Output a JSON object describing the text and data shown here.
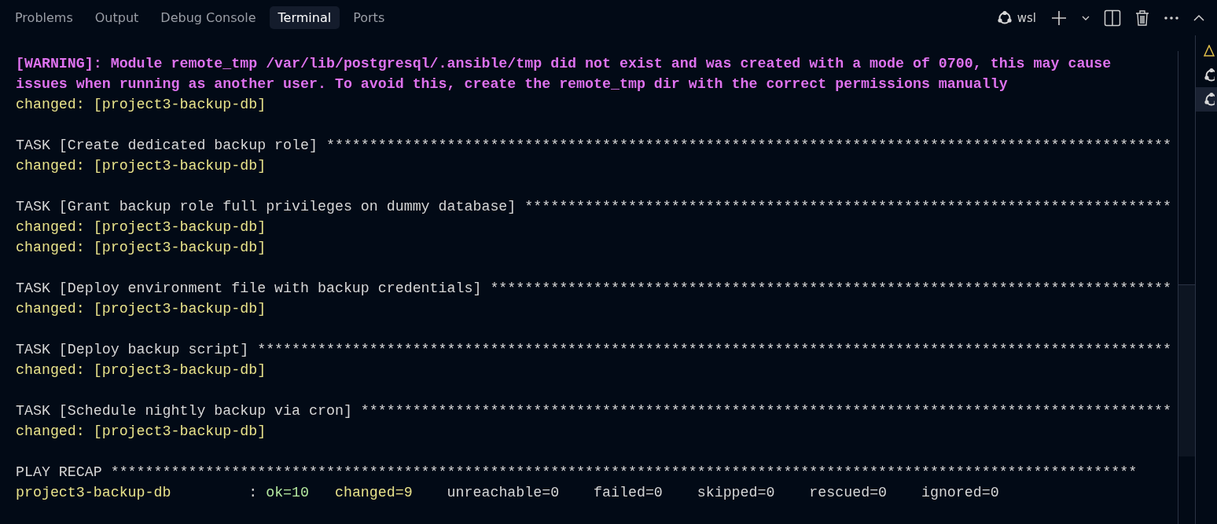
{
  "tabs": [
    {
      "label": "Problems",
      "selected": false
    },
    {
      "label": "Output",
      "selected": false
    },
    {
      "label": "Debug Console",
      "selected": false
    },
    {
      "label": "Terminal",
      "selected": true
    },
    {
      "label": "Ports",
      "selected": false
    }
  ],
  "toolbar": {
    "profile": "wsl"
  },
  "terminal": {
    "lines": [
      {
        "kind": "text",
        "segments": [
          {
            "text": "[WARNING]: Module remote_tmp /var/lib/postgresql/.ansible/tmp did not exist and was created with a mode of 0700, this may cause",
            "kind": "warning"
          }
        ]
      },
      {
        "kind": "text",
        "segments": [
          {
            "text": "issues when running as another user. To avoid this, create the remote_tmp dir with the correct permissions manually",
            "kind": "warning"
          }
        ]
      },
      {
        "kind": "text",
        "segments": [
          {
            "text": "changed: [project3-backup-db]",
            "kind": "changed"
          }
        ]
      },
      {
        "kind": "blank"
      },
      {
        "kind": "text",
        "segments": [
          {
            "text": "TASK [Create dedicated backup role] **************************************************************************************************",
            "kind": "plain"
          }
        ]
      },
      {
        "kind": "text",
        "segments": [
          {
            "text": "changed: [project3-backup-db]",
            "kind": "changed"
          }
        ]
      },
      {
        "kind": "blank"
      },
      {
        "kind": "text",
        "segments": [
          {
            "text": "TASK [Grant backup role full privileges on dummy database] ***************************************************************************",
            "kind": "plain"
          }
        ]
      },
      {
        "kind": "text",
        "segments": [
          {
            "text": "changed: [project3-backup-db]",
            "kind": "changed"
          }
        ]
      },
      {
        "kind": "text",
        "segments": [
          {
            "text": "changed: [project3-backup-db]",
            "kind": "changed"
          }
        ]
      },
      {
        "kind": "blank"
      },
      {
        "kind": "text",
        "segments": [
          {
            "text": "TASK [Deploy environment file with backup credentials] *******************************************************************************",
            "kind": "plain"
          }
        ]
      },
      {
        "kind": "text",
        "segments": [
          {
            "text": "changed: [project3-backup-db]",
            "kind": "changed"
          }
        ]
      },
      {
        "kind": "blank"
      },
      {
        "kind": "text",
        "segments": [
          {
            "text": "TASK [Deploy backup script] **********************************************************************************************************",
            "kind": "plain"
          }
        ]
      },
      {
        "kind": "text",
        "segments": [
          {
            "text": "changed: [project3-backup-db]",
            "kind": "changed"
          }
        ]
      },
      {
        "kind": "blank"
      },
      {
        "kind": "text",
        "segments": [
          {
            "text": "TASK [Schedule nightly backup via cron] **********************************************************************************************",
            "kind": "plain"
          }
        ]
      },
      {
        "kind": "text",
        "segments": [
          {
            "text": "changed: [project3-backup-db]",
            "kind": "changed"
          }
        ]
      },
      {
        "kind": "blank"
      },
      {
        "kind": "text",
        "segments": [
          {
            "text": "PLAY RECAP ***********************************************************************************************************************",
            "kind": "plain"
          }
        ]
      },
      {
        "kind": "text",
        "segments": [
          {
            "text": "project3-backup-db",
            "kind": "changed"
          },
          {
            "text": "         : ",
            "kind": "plain"
          },
          {
            "text": "ok=10   ",
            "kind": "ok"
          },
          {
            "text": "changed=9",
            "kind": "changed"
          },
          {
            "text": "    unreachable=0    failed=0    skipped=0    rescued=0    ignored=0",
            "kind": "plain"
          }
        ]
      }
    ]
  },
  "terminal_list": [
    {
      "kind": "warning",
      "selected": false
    },
    {
      "kind": "shell",
      "selected": false
    },
    {
      "kind": "shell",
      "selected": true
    }
  ]
}
